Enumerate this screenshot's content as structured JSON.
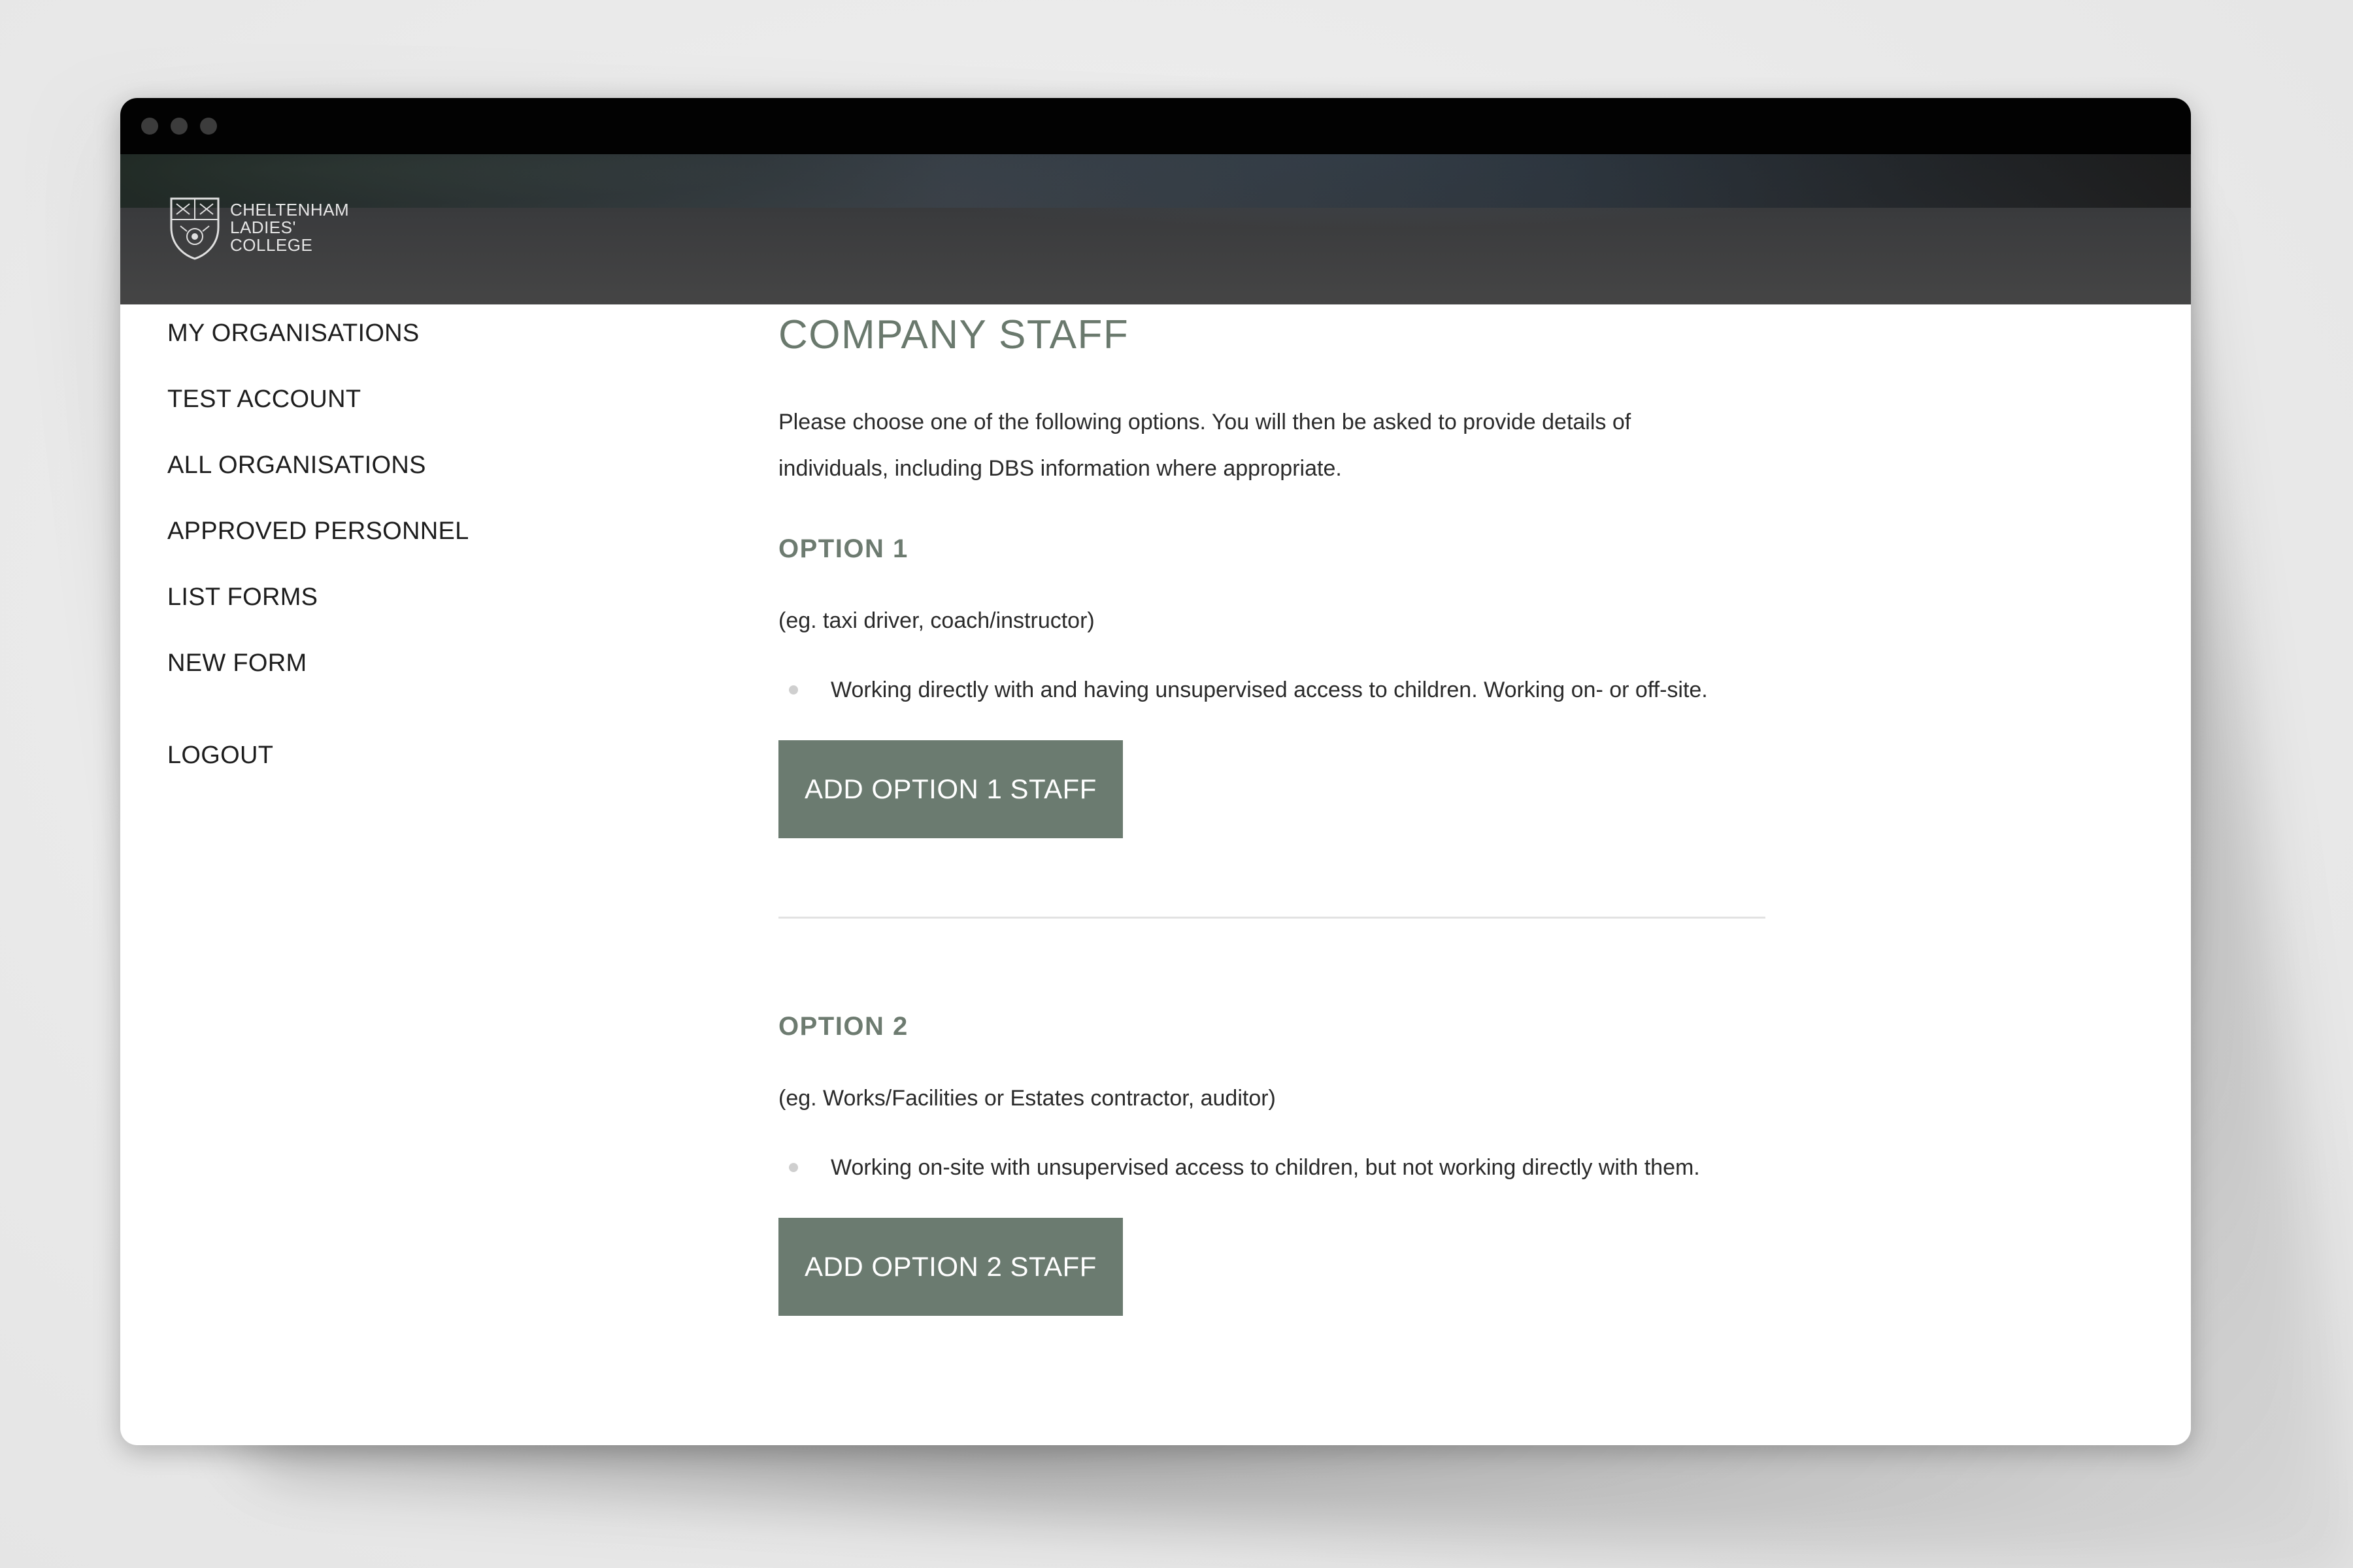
{
  "header": {
    "logo_lines": [
      "CHELTENHAM",
      "LADIES'",
      "COLLEGE"
    ],
    "icons": {
      "logo": "crest-icon"
    }
  },
  "sidebar": {
    "items": [
      {
        "label": "MY ORGANISATIONS"
      },
      {
        "label": "TEST ACCOUNT"
      },
      {
        "label": "ALL ORGANISATIONS"
      },
      {
        "label": "APPROVED PERSONNEL"
      },
      {
        "label": "LIST FORMS"
      },
      {
        "label": "NEW FORM"
      }
    ],
    "logout_label": "LOGOUT"
  },
  "main": {
    "title": "COMPANY STAFF",
    "intro": "Please choose one of the following options. You will then be asked to provide details of individuals, including DBS information where appropriate.",
    "options": [
      {
        "heading": "OPTION 1",
        "example": "(eg. taxi driver, coach/instructor)",
        "bullet": "Working directly with and having unsupervised access to children. Working on- or off-site.",
        "button_label": "ADD OPTION 1 STAFF"
      },
      {
        "heading": "OPTION 2",
        "example": "(eg. Works/Facilities or Estates contractor, auditor)",
        "bullet": "Working on-site with unsupervised access to children, but not working directly with them.",
        "button_label": "ADD OPTION 2 STAFF"
      }
    ]
  },
  "colors": {
    "accent": "#6b7b70",
    "heading": "#6a796d",
    "titlebar": "#020202"
  }
}
